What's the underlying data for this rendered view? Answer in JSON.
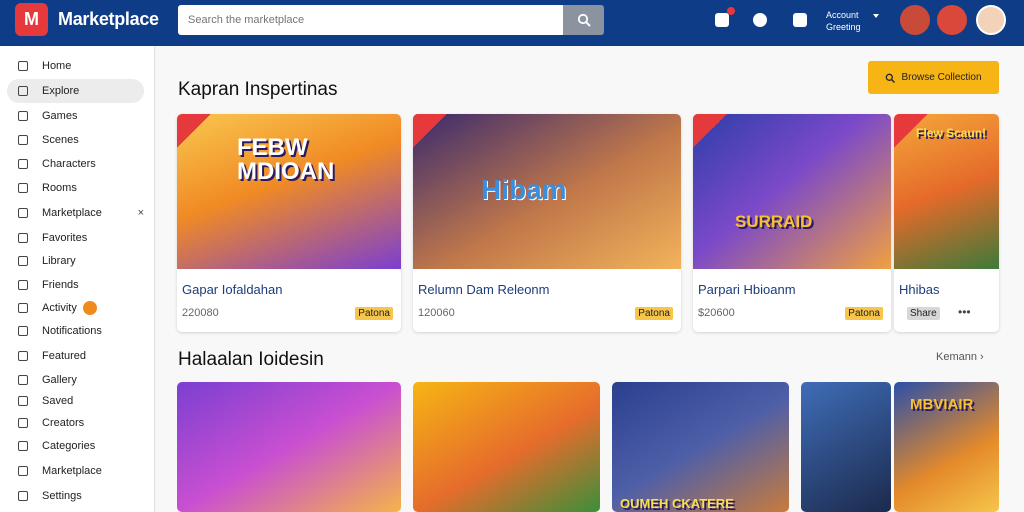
{
  "header": {
    "logo_text": "M",
    "brand": "Marketplace",
    "search_placeholder": "Search the marketplace",
    "account_line1": "Account",
    "account_line2": "Greeting"
  },
  "sidebar": {
    "items": [
      {
        "label": "Home",
        "icon": "home-icon"
      },
      {
        "label": "Explore",
        "icon": "compass-icon",
        "active": true
      },
      {
        "label": "Games",
        "icon": "gamepad-icon"
      },
      {
        "label": "Scenes",
        "icon": "scene-icon"
      },
      {
        "label": "Characters",
        "icon": "character-icon"
      },
      {
        "label": "Rooms",
        "icon": "room-icon"
      },
      {
        "label": "Marketplace",
        "icon": "store-icon",
        "close": "×"
      },
      {
        "label": "Favorites",
        "icon": "heart-icon"
      },
      {
        "label": "Library",
        "icon": "library-icon"
      },
      {
        "label": "Friends",
        "icon": "friends-icon"
      },
      {
        "label": "Activity",
        "icon": "activity-icon",
        "badge": true
      },
      {
        "label": "Notifications",
        "icon": "bell-icon"
      },
      {
        "label": "Featured",
        "icon": "star-icon"
      },
      {
        "label": "Gallery",
        "icon": "gallery-icon"
      },
      {
        "label": "Saved",
        "icon": "bookmark-icon"
      },
      {
        "label": "Creators",
        "icon": "creators-icon"
      },
      {
        "label": "Categories",
        "icon": "categories-icon"
      },
      {
        "label": "Marketplace",
        "icon": "market-icon"
      },
      {
        "label": "Settings",
        "icon": "settings-icon"
      }
    ]
  },
  "main": {
    "section1_title": "Kapran Inspertinas",
    "section1_button": "Browse Collection",
    "section2_title": "Halaalan Ioidesin",
    "section2_link": "Kemann",
    "cards": [
      {
        "img_text": "FEBW MDIOAN",
        "title": "Gapar Iofaldahan",
        "price": "220080",
        "tag": "Patona"
      },
      {
        "img_text": "Hibam",
        "title": "Relumn Dam Releonm",
        "price": "120060",
        "tag": "Patona"
      },
      {
        "img_text": "SURRAID",
        "title": "Parpari Hbioanm",
        "price": "$20600",
        "tag": "Patona"
      },
      {
        "img_text": "Flew Scaun!",
        "title": "Hhibas",
        "price": "",
        "tag": "Share",
        "more": "•••"
      }
    ],
    "tiles": [
      {
        "img_text": ""
      },
      {
        "img_text": ""
      },
      {
        "img_text": "OUMEH CKATERE"
      },
      {
        "img_text": ""
      },
      {
        "img_text": "MBVIAIR"
      }
    ]
  },
  "colors": {
    "header_bg": "#0f3c86",
    "accent_red": "#e5393b",
    "accent_yellow": "#f6b514"
  }
}
